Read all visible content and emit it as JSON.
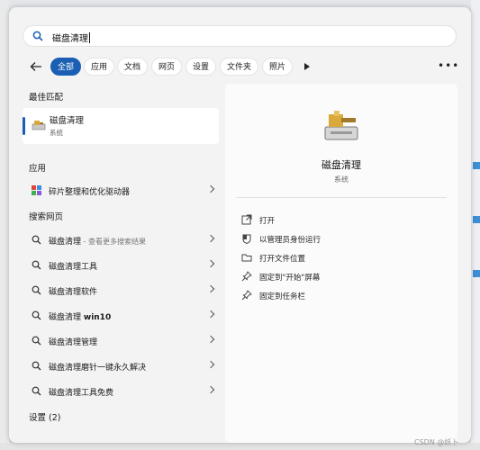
{
  "search": {
    "query": "磁盘清理"
  },
  "filters": [
    "全部",
    "应用",
    "文档",
    "网页",
    "设置",
    "文件夹",
    "照片"
  ],
  "sections": {
    "best_match": "最佳匹配",
    "apps": "应用",
    "web": "搜索网页",
    "settings": "设置 (2)"
  },
  "best_match": {
    "title": "磁盘清理",
    "subtitle": "系统"
  },
  "apps": [
    {
      "label": "碎片整理和优化驱动器"
    }
  ],
  "web_results": [
    {
      "label": "磁盘清理",
      "hint": " - 查看更多搜索结果"
    },
    {
      "label": "磁盘清理工具"
    },
    {
      "label": "磁盘清理软件"
    },
    {
      "label": "磁盘清理 ",
      "bold": "win10"
    },
    {
      "label": "磁盘清理管理"
    },
    {
      "label": "磁盘清理磨针一键永久解决"
    },
    {
      "label": "磁盘清理工具免费"
    }
  ],
  "details": {
    "name": "磁盘清理",
    "type": "系统",
    "actions": [
      {
        "label": "打开",
        "icon": "open-icon"
      },
      {
        "label": "以管理员身份运行",
        "icon": "shield-icon"
      },
      {
        "label": "打开文件位置",
        "icon": "folder-icon"
      },
      {
        "label": "固定到\"开始\"屏幕",
        "icon": "pin-icon"
      },
      {
        "label": "固定到任务栏",
        "icon": "pin-icon"
      }
    ]
  },
  "watermark": "CSDN @妖卜"
}
